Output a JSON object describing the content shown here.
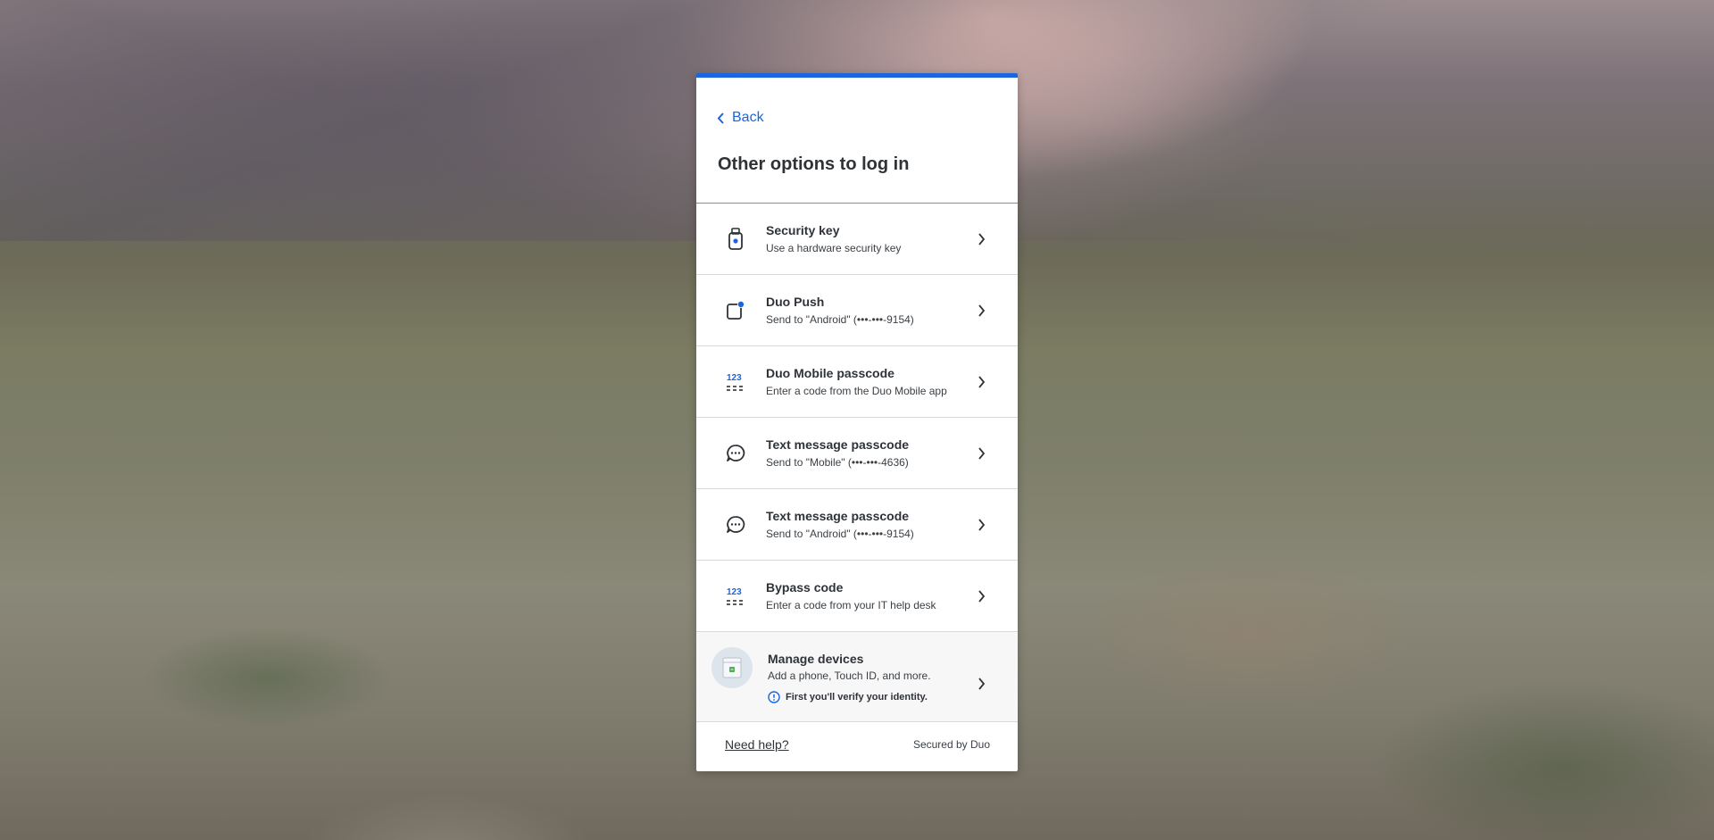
{
  "header": {
    "back_label": "Back",
    "title": "Other options to log in"
  },
  "options": [
    {
      "icon": "security-key-icon",
      "title": "Security key",
      "subtitle": "Use a hardware security key"
    },
    {
      "icon": "duo-push-icon",
      "title": "Duo Push",
      "subtitle": "Send to \"Android\" (•••-•••-9154)"
    },
    {
      "icon": "passcode-icon",
      "title": "Duo Mobile passcode",
      "subtitle": "Enter a code from the Duo Mobile app"
    },
    {
      "icon": "text-message-icon",
      "title": "Text message passcode",
      "subtitle": "Send to \"Mobile\" (•••-•••-4636)"
    },
    {
      "icon": "text-message-icon",
      "title": "Text message passcode",
      "subtitle": "Send to \"Android\" (•••-•••-9154)"
    },
    {
      "icon": "passcode-icon",
      "title": "Bypass code",
      "subtitle": "Enter a code from your IT help desk"
    }
  ],
  "manage": {
    "icon": "manage-devices-icon",
    "title": "Manage devices",
    "subtitle": "Add a phone, Touch ID, and more.",
    "note": "First you'll verify your identity."
  },
  "footer": {
    "help_label": "Need help?",
    "secured_label": "Secured by Duo"
  },
  "colors": {
    "accent": "#1a66e0",
    "text": "#2f3337"
  }
}
